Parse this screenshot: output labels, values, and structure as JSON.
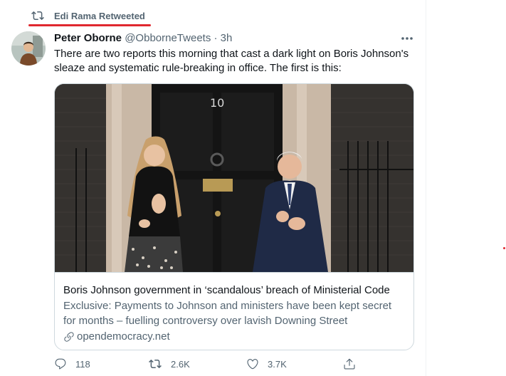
{
  "retweet": {
    "text": "Edi Rama Retweeted"
  },
  "tweet": {
    "author_name": "Peter Oborne",
    "handle": "@ObborneTweets",
    "separator": "·",
    "time": "3h",
    "text": "There are two reports this morning that cast a dark light on Boris Johnson's sleaze and systematic rule-breaking in office. The first is this:"
  },
  "card": {
    "title": "Boris Johnson government in ‘scandalous’ breach of Ministerial Code",
    "description": "Exclusive: Payments to Johnson and ministers have been kept secret for months – fuelling controversy over lavish Downing Street refurbishme...",
    "domain": "opendemocracy.net",
    "door_number": "10"
  },
  "actions": {
    "replies": "118",
    "retweets": "2.6K",
    "likes": "3.7K"
  },
  "colors": {
    "accent_red": "#e0282f",
    "secondary_text": "#536471",
    "border": "#cfd9de"
  }
}
